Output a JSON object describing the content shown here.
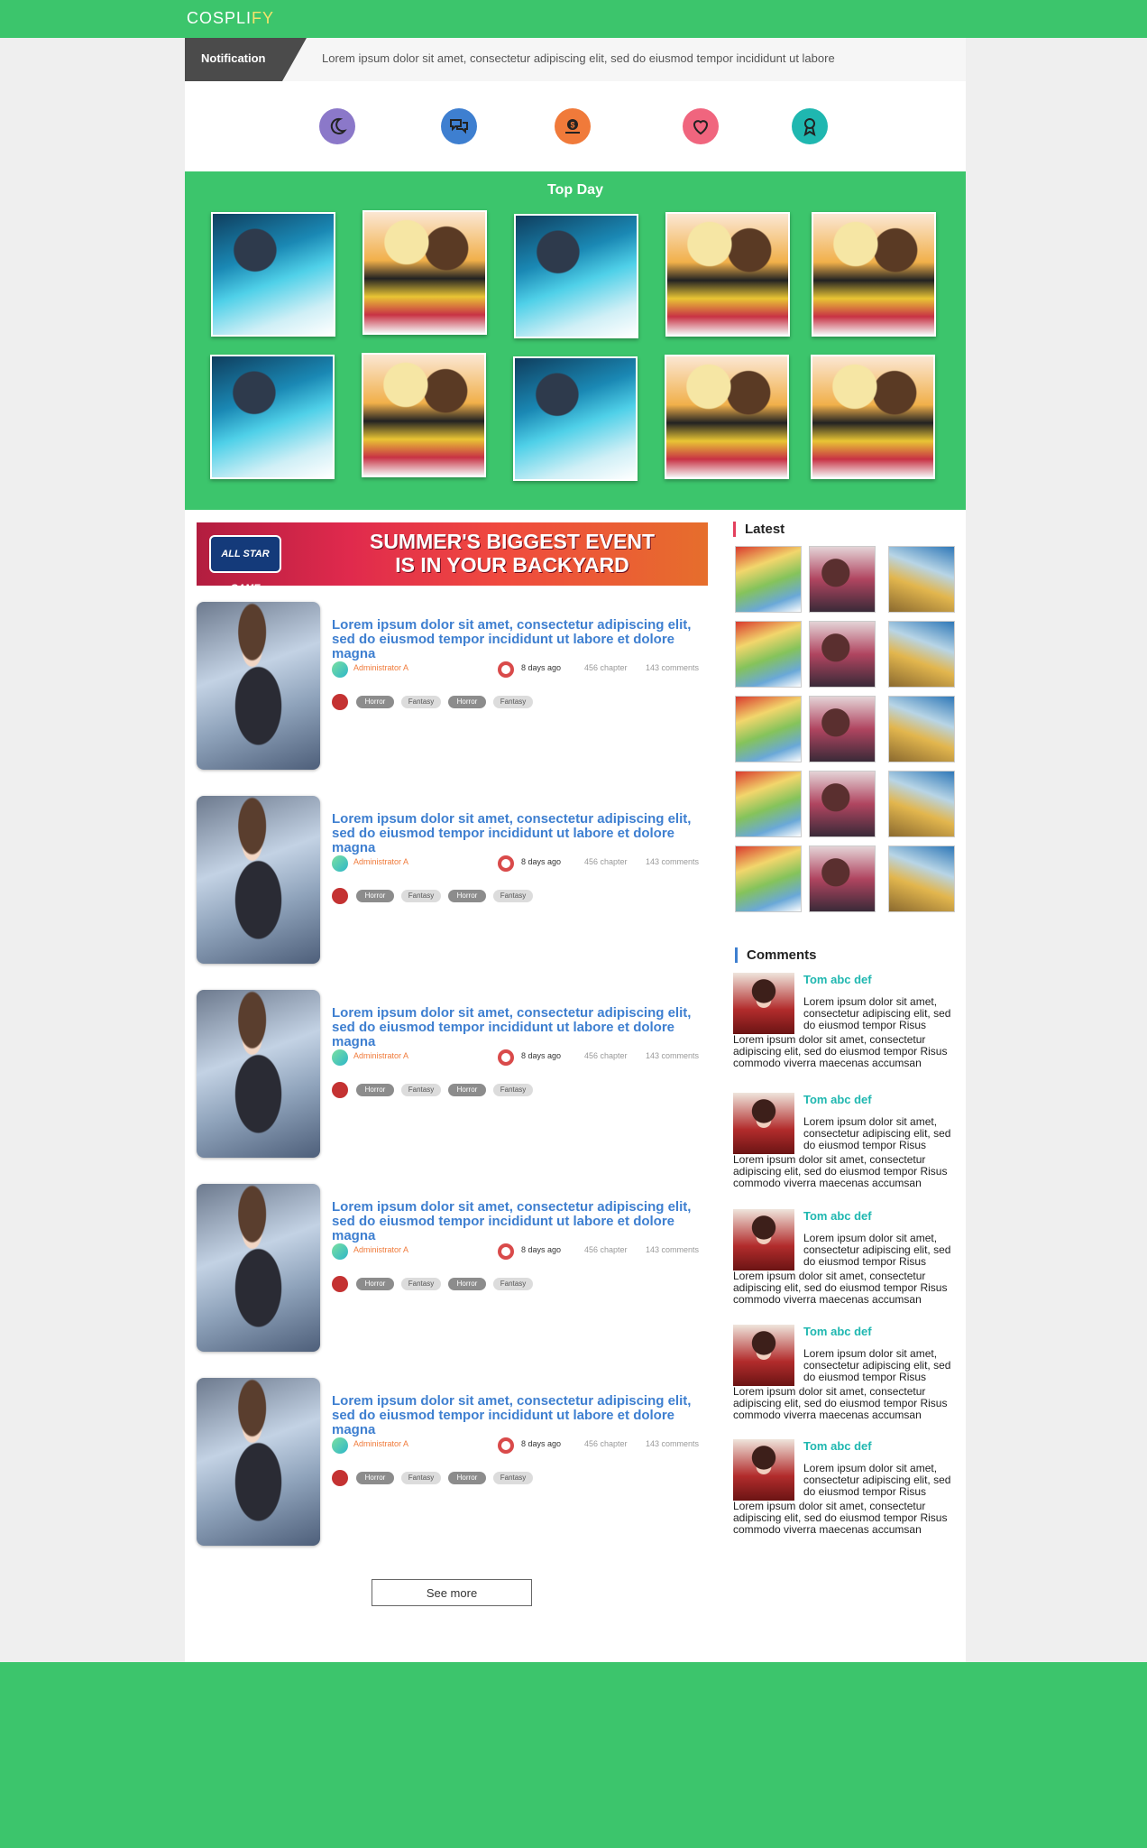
{
  "brand": {
    "logo_main": "COSPLI",
    "logo_accent": "FY"
  },
  "notification": {
    "label": "Notification",
    "text": "Lorem ipsum dolor sit amet, consectetur adipiscing elit, sed do eiusmod tempor incididunt ut labore"
  },
  "quick_icons": [
    {
      "icon": "moon-icon",
      "color": "#8b78c9"
    },
    {
      "icon": "chat-icon",
      "color": "#3e7fd0"
    },
    {
      "icon": "coin-icon",
      "color": "#f07a3a"
    },
    {
      "icon": "heart-icon",
      "color": "#f0657e"
    },
    {
      "icon": "award-icon",
      "color": "#1fb7b0"
    }
  ],
  "top_day": {
    "title": "Top Day",
    "items": [
      "blue-haired-girl",
      "two-girls",
      "blue-haired-girl",
      "two-girls",
      "two-girls",
      "blue-haired-girl",
      "two-girls",
      "blue-haired-girl",
      "two-girls",
      "two-girls"
    ]
  },
  "banner": {
    "badge": "ALL STAR GAME",
    "line1": "SUMMER'S BIGGEST EVENT",
    "line2": "IS IN YOUR BACKYARD"
  },
  "posts": [
    {
      "title": "Lorem ipsum dolor sit amet, consectetur adipiscing elit, sed do eiusmod tempor incididunt ut labore et dolore magna",
      "author": "Administrator A",
      "time": "8 days ago",
      "chapters": "456 chapter",
      "comments": "143 comments",
      "tags": [
        "Horror",
        "Fantasy",
        "Horror",
        "Fantasy"
      ]
    },
    {
      "title": "Lorem ipsum dolor sit amet, consectetur adipiscing elit, sed do eiusmod tempor incididunt ut labore et dolore magna",
      "author": "Administrator A",
      "time": "8 days ago",
      "chapters": "456 chapter",
      "comments": "143 comments",
      "tags": [
        "Horror",
        "Fantasy",
        "Horror",
        "Fantasy"
      ]
    },
    {
      "title": "Lorem ipsum dolor sit amet, consectetur adipiscing elit, sed do eiusmod tempor incididunt ut labore et dolore magna",
      "author": "Administrator A",
      "time": "8 days ago",
      "chapters": "456 chapter",
      "comments": "143 comments",
      "tags": [
        "Horror",
        "Fantasy",
        "Horror",
        "Fantasy"
      ]
    },
    {
      "title": "Lorem ipsum dolor sit amet, consectetur adipiscing elit, sed do eiusmod tempor incididunt ut labore et dolore magna",
      "author": "Administrator A",
      "time": "8 days ago",
      "chapters": "456 chapter",
      "comments": "143 comments",
      "tags": [
        "Horror",
        "Fantasy",
        "Horror",
        "Fantasy"
      ]
    },
    {
      "title": "Lorem ipsum dolor sit amet, consectetur adipiscing elit, sed do eiusmod tempor incididunt ut labore et dolore magna",
      "author": "Administrator A",
      "time": "8 days ago",
      "chapters": "456 chapter",
      "comments": "143 comments",
      "tags": [
        "Horror",
        "Fantasy",
        "Horror",
        "Fantasy"
      ]
    }
  ],
  "see_more": "See more",
  "sidebar": {
    "latest_title": "Latest",
    "comments_title": "Comments",
    "comments": [
      {
        "name": "Tom abc def",
        "text1": "Lorem ipsum dolor sit amet, consectetur adipiscing elit, sed do eiusmod tempor Risus",
        "text2": "Lorem ipsum dolor sit amet, consectetur adipiscing elit, sed do eiusmod tempor Risus commodo viverra maecenas accumsan"
      },
      {
        "name": "Tom abc def",
        "text1": "Lorem ipsum dolor sit amet, consectetur adipiscing elit, sed do eiusmod tempor Risus",
        "text2": "Lorem ipsum dolor sit amet, consectetur adipiscing elit, sed do eiusmod tempor Risus commodo viverra maecenas accumsan"
      },
      {
        "name": "Tom abc def",
        "text1": "Lorem ipsum dolor sit amet, consectetur adipiscing elit, sed do eiusmod tempor Risus",
        "text2": "Lorem ipsum dolor sit amet, consectetur adipiscing elit, sed do eiusmod tempor Risus commodo viverra maecenas accumsan"
      },
      {
        "name": "Tom abc def",
        "text1": "Lorem ipsum dolor sit amet, consectetur adipiscing elit, sed do eiusmod tempor Risus",
        "text2": "Lorem ipsum dolor sit amet, consectetur adipiscing elit, sed do eiusmod tempor Risus commodo viverra maecenas accumsan"
      },
      {
        "name": "Tom abc def",
        "text1": "Lorem ipsum dolor sit amet, consectetur adipiscing elit, sed do eiusmod tempor Risus",
        "text2": "Lorem ipsum dolor sit amet, consectetur adipiscing elit, sed do eiusmod tempor Risus commodo viverra maecenas accumsan"
      }
    ]
  },
  "colors": {
    "brand_green": "#3cc56c",
    "link_blue": "#3e7fd0",
    "author_orange": "#f07a3a",
    "comment_teal": "#1fb7b0"
  }
}
